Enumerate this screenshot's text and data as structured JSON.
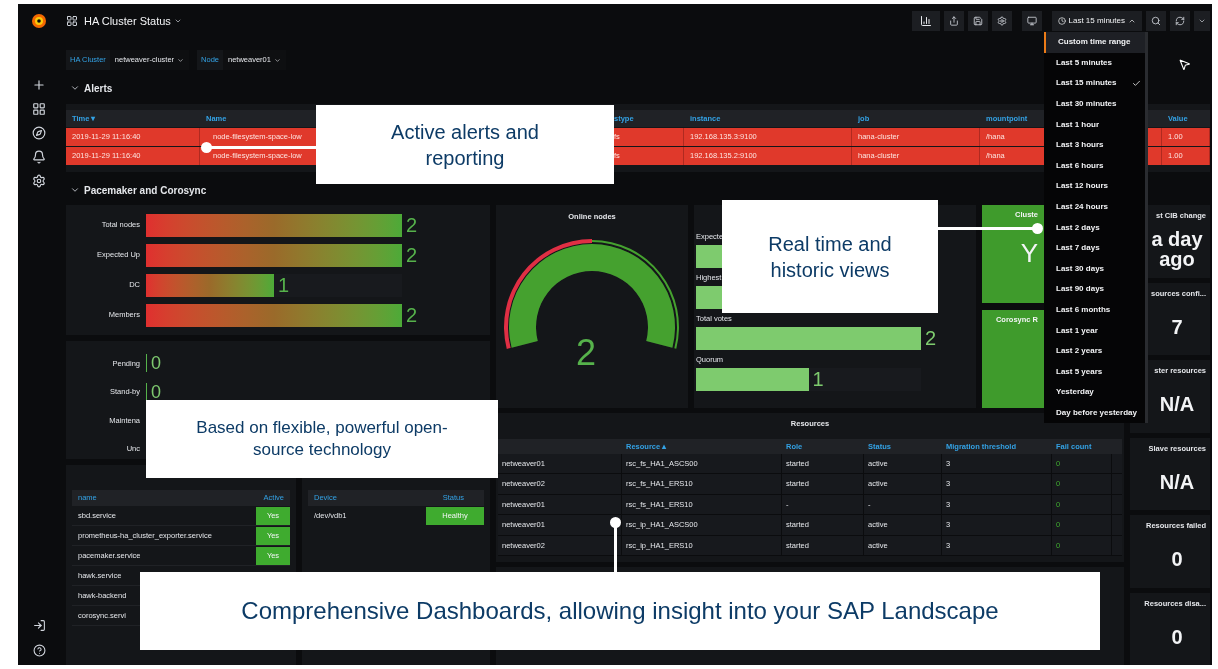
{
  "dashboard": {
    "title": "HA Cluster Status"
  },
  "toolbar": {
    "time_range": "Last 15 minutes"
  },
  "variables": [
    {
      "label": "HA Cluster",
      "value": "netweaver-cluster"
    },
    {
      "label": "Node",
      "value": "netweaver01"
    }
  ],
  "alerts": {
    "heading": "Alerts",
    "expanded": true,
    "columns": [
      "Time ▾",
      "Name",
      "stype",
      "instance",
      "job",
      "mountpoint",
      "Value"
    ],
    "rows": [
      {
        "alerting": true,
        "cells": [
          "2019-11-29 11:16:40",
          "node-filesystem-space-low",
          "fs",
          "192.168.135.3:9100",
          "hana-cluster",
          "/hana",
          "1.00"
        ]
      },
      {
        "alerting": true,
        "cells": [
          "2019-11-29 11:16:40",
          "node-filesystem-space-low",
          "fs",
          "192.168.135.2:9100",
          "hana-cluster",
          "/hana",
          "1.00"
        ]
      }
    ]
  },
  "pacemaker": {
    "heading": "Pacemaker and Corosync",
    "expanded": true,
    "node_bars": [
      {
        "label": "Total nodes",
        "value": "2",
        "level": 1
      },
      {
        "label": "Expected Up",
        "value": "2",
        "level": 1
      },
      {
        "label": "DC",
        "value": "1",
        "level": 0.5
      },
      {
        "label": "Members",
        "value": "2",
        "level": 1
      }
    ],
    "node_states": [
      {
        "label": "Pending",
        "value": "0"
      },
      {
        "label": "Stand-by",
        "value": "0"
      },
      {
        "label": "Maintena"
      },
      {
        "label": "Unc"
      }
    ],
    "online_nodes": {
      "title": "Online nodes",
      "value": "2",
      "level": 1
    },
    "votes": [
      {
        "label": "Expecte",
        "level": 1
      },
      {
        "label": "Highest",
        "level": 1
      },
      {
        "label": "Total votes",
        "value": "2",
        "level": 1
      },
      {
        "label": "Quorum",
        "value": "1",
        "level": 0.5
      }
    ],
    "cluster": {
      "title": "Cluste",
      "value": "Y"
    },
    "corosync": {
      "title": "Corosync R"
    },
    "stats": [
      {
        "title": "st CIB change",
        "value": "a day ago"
      },
      {
        "title": "sources confi...",
        "value": "7"
      },
      {
        "title": "ster resources",
        "value": "N/A"
      },
      {
        "title": "Slave resources",
        "value": "N/A"
      },
      {
        "title": "Resources failed",
        "value": "0"
      },
      {
        "title": "Resources disa...",
        "value": "0"
      }
    ],
    "systemd": {
      "columns": [
        "name",
        "Active"
      ],
      "rows": [
        {
          "name": "sbd.service",
          "active": "Yes"
        },
        {
          "name": "prometheus-ha_cluster_exporter.service",
          "active": "Yes"
        },
        {
          "name": "pacemaker.service",
          "active": "Yes"
        },
        {
          "name": "hawk.service"
        },
        {
          "name": "hawk-backend"
        },
        {
          "name": "corosync.servi"
        }
      ]
    },
    "sbd": {
      "columns": [
        "Device",
        "Status"
      ],
      "rows": [
        {
          "device": "/dev/vdb1",
          "status": "Healthy"
        }
      ]
    },
    "resources": {
      "title": "Resources",
      "columns": [
        "",
        "Resource ▴",
        "Role",
        "Status",
        "Migration threshold",
        "Fail count"
      ],
      "rows": [
        [
          "netweaver01",
          "rsc_fs_HA1_ASCS00",
          "started",
          "active",
          "3",
          "0"
        ],
        [
          "netweaver02",
          "rsc_fs_HA1_ERS10",
          "started",
          "active",
          "3",
          "0"
        ],
        [
          "netweaver01",
          "rsc_fs_HA1_ERS10",
          "-",
          "-",
          "3",
          "0"
        ],
        [
          "netweaver01",
          "rsc_ip_HA1_ASCS00",
          "started",
          "active",
          "3",
          "0"
        ],
        [
          "netweaver02",
          "rsc_ip_HA1_ERS10",
          "started",
          "active",
          "3",
          "0"
        ]
      ]
    }
  },
  "time_menu": [
    {
      "label": "Custom time range",
      "selected": false,
      "highlighted": true
    },
    {
      "label": "Last 5 minutes",
      "selected": false,
      "highlighted": false
    },
    {
      "label": "Last 15 minutes",
      "selected": true,
      "highlighted": false
    },
    {
      "label": "Last 30 minutes",
      "selected": false,
      "highlighted": false
    },
    {
      "label": "Last 1 hour",
      "selected": false,
      "highlighted": false
    },
    {
      "label": "Last 3 hours",
      "selected": false,
      "highlighted": false
    },
    {
      "label": "Last 6 hours",
      "selected": false,
      "highlighted": false
    },
    {
      "label": "Last 12 hours",
      "selected": false,
      "highlighted": false
    },
    {
      "label": "Last 24 hours",
      "selected": false,
      "highlighted": false
    },
    {
      "label": "Last 2 days",
      "selected": false,
      "highlighted": false
    },
    {
      "label": "Last 7 days",
      "selected": false,
      "highlighted": false
    },
    {
      "label": "Last 30 days",
      "selected": false,
      "highlighted": false
    },
    {
      "label": "Last 90 days",
      "selected": false,
      "highlighted": false
    },
    {
      "label": "Last 6 months",
      "selected": false,
      "highlighted": false
    },
    {
      "label": "Last 1 year",
      "selected": false,
      "highlighted": false
    },
    {
      "label": "Last 2 years",
      "selected": false,
      "highlighted": false
    },
    {
      "label": "Last 5 years",
      "selected": false,
      "highlighted": false
    },
    {
      "label": "Yesterday",
      "selected": false,
      "highlighted": false
    },
    {
      "label": "Day before yesterday",
      "selected": false,
      "highlighted": false
    }
  ],
  "callouts": [
    {
      "text": "Active alerts and reporting"
    },
    {
      "text": "Real time and historic views"
    },
    {
      "text": "Based on flexible, powerful open-source technology"
    },
    {
      "text": "Comprehensive Dashboards, allowing insight into your SAP Landscape"
    }
  ]
}
